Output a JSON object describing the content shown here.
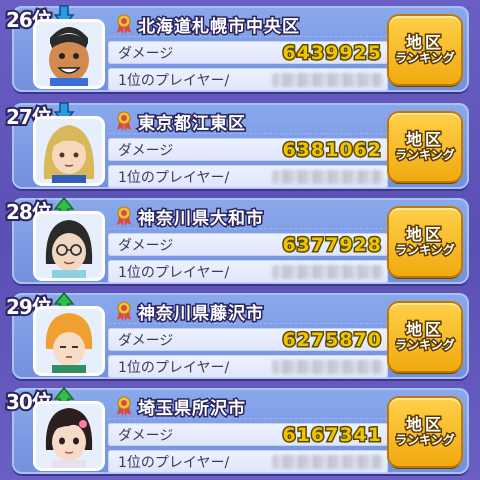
{
  "rankings": [
    {
      "rank": "26位",
      "trend": "down",
      "region": "北海道札幌市中央区",
      "damage_label": "ダメージ",
      "damage": "6439925",
      "player_label": "1位のプレイヤー/",
      "button_line1": "地区",
      "button_line2": "ランキング",
      "avatar": "tan-boy-avatar"
    },
    {
      "rank": "27位",
      "trend": "down",
      "region": "東京都江東区",
      "damage_label": "ダメージ",
      "damage": "6381062",
      "player_label": "1位のプレイヤー/",
      "button_line1": "地区",
      "button_line2": "ランキング",
      "avatar": "blonde-girl-avatar"
    },
    {
      "rank": "28位",
      "trend": "up",
      "region": "神奈川県大和市",
      "damage_label": "ダメージ",
      "damage": "6377928",
      "player_label": "1位のプレイヤー/",
      "button_line1": "地区",
      "button_line2": "ランキング",
      "avatar": "glasses-girl-avatar"
    },
    {
      "rank": "29位",
      "trend": "up",
      "region": "神奈川県藤沢市",
      "damage_label": "ダメージ",
      "damage": "6275870",
      "player_label": "1位のプレイヤー/",
      "button_line1": "地区",
      "button_line2": "ランキング",
      "avatar": "orange-hood-avatar"
    },
    {
      "rank": "30位",
      "trend": "up",
      "region": "埼玉県所沢市",
      "damage_label": "ダメージ",
      "damage": "6167341",
      "player_label": "1位のプレイヤー/",
      "button_line1": "地区",
      "button_line2": "ランキング",
      "avatar": "dark-hair-girl-avatar"
    }
  ],
  "colors": {
    "trend_up": "#2fbf4a",
    "trend_down": "#2a9be6",
    "damage_text": "#f0c400",
    "button": "#f1aa10"
  }
}
